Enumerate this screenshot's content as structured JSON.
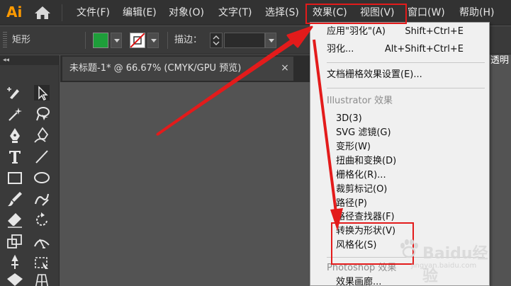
{
  "app": {
    "logo_text": "Ai"
  },
  "menubar": {
    "items": [
      {
        "label": "文件(F)"
      },
      {
        "label": "编辑(E)"
      },
      {
        "label": "对象(O)"
      },
      {
        "label": "文字(T)"
      },
      {
        "label": "选择(S)"
      },
      {
        "label": "效果(C)"
      },
      {
        "label": "视图(V)"
      },
      {
        "label": "窗口(W)"
      },
      {
        "label": "帮助(H)"
      }
    ]
  },
  "control_bar": {
    "selection_label": "矩形",
    "fill_color": "#1e9e3a",
    "stroke_label": "描边：",
    "opacity_label": "透明"
  },
  "tool_panel": {
    "collapse_glyph": "◂◂"
  },
  "document": {
    "tab_title": "未标题-1* @ 66.67% (CMYK/GPU 预览)",
    "close_glyph": "×"
  },
  "effect_menu": {
    "items": [
      {
        "label": "应用\"羽化\"(A)",
        "shortcut": "Shift+Ctrl+E"
      },
      {
        "label": "羽化...",
        "shortcut": "Alt+Shift+Ctrl+E"
      },
      {
        "label": "文档栅格效果设置(E)..."
      },
      {
        "label": "Illustrator 效果"
      },
      {
        "label": "3D(3)"
      },
      {
        "label": "SVG 滤镜(G)"
      },
      {
        "label": "变形(W)"
      },
      {
        "label": "扭曲和变换(D)"
      },
      {
        "label": "栅格化(R)..."
      },
      {
        "label": "裁剪标记(O)"
      },
      {
        "label": "路径(P)"
      },
      {
        "label": "路径查找器(F)"
      },
      {
        "label": "转换为形状(V)"
      },
      {
        "label": "风格化(S)"
      },
      {
        "label": "Photoshop 效果"
      },
      {
        "label": "效果画廊..."
      }
    ]
  },
  "annotation": {
    "highlight_color": "#e31b1b"
  },
  "watermark": {
    "logo_text": "Baidu经验",
    "subtext": "jingyan.baidu.com"
  }
}
